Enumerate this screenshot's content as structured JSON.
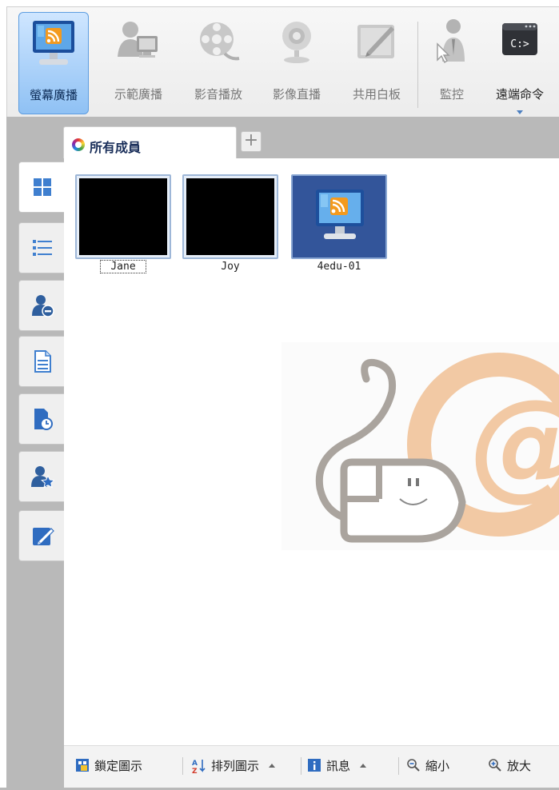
{
  "toolbar": {
    "items": [
      {
        "label": "螢幕廣播",
        "icon": "screen-broadcast-icon",
        "active": true
      },
      {
        "label": "示範廣播",
        "icon": "demo-broadcast-icon"
      },
      {
        "label": "影音播放",
        "icon": "media-play-icon"
      },
      {
        "label": "影像直播",
        "icon": "webcam-live-icon"
      },
      {
        "label": "共用白板",
        "icon": "whiteboard-icon"
      },
      {
        "label": "監控",
        "icon": "monitor-user-icon"
      },
      {
        "label": "遠端命令",
        "icon": "remote-command-icon",
        "has_dropdown": true
      }
    ]
  },
  "tabs": {
    "active_label": "所有成員",
    "add_label": "+"
  },
  "side_tabs": [
    {
      "icon": "grid-view-icon",
      "active": true
    },
    {
      "icon": "list-view-icon"
    },
    {
      "icon": "remove-user-icon"
    },
    {
      "icon": "document-icon"
    },
    {
      "icon": "history-icon"
    },
    {
      "icon": "favorite-user-icon"
    },
    {
      "icon": "edit-icon"
    }
  ],
  "members": [
    {
      "name": "Jane",
      "state": "black-screen",
      "focused": true
    },
    {
      "name": "Joy",
      "state": "black-screen"
    },
    {
      "name": "4edu-01",
      "state": "broadcasting",
      "selected": true
    }
  ],
  "statusbar": {
    "lock_label": "鎖定圖示",
    "sort_label": "排列圖示",
    "info_label": "訊息",
    "zoom_out_label": "縮小",
    "zoom_in_label": "放大"
  },
  "colors": {
    "accent": "#5d9de0",
    "selected_thumb": "#33559a",
    "gray_frame": "#b9b9b9",
    "watermark_orange": "#f2c9a4"
  }
}
